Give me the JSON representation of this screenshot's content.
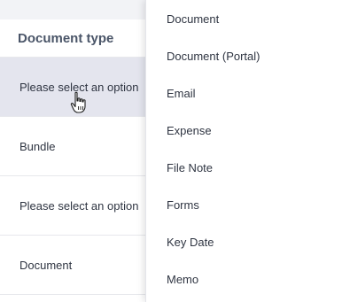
{
  "table": {
    "header": "Document type",
    "rows": [
      {
        "label": "Please select an option",
        "hovered": true
      },
      {
        "label": "Bundle"
      },
      {
        "label": "Please select an option"
      },
      {
        "label": "Document"
      }
    ]
  },
  "dropdown": {
    "options": [
      "Document",
      "Document (Portal)",
      "Email",
      "Expense",
      "File Note",
      "Forms",
      "Key Date",
      "Memo"
    ]
  },
  "cursor": {
    "icon": "hand-pointer-icon"
  },
  "colors": {
    "page_bg": "#f2f3f6",
    "row_hover": "#e4e5ee",
    "text": "#2f3542",
    "header_text": "#4a5568"
  }
}
